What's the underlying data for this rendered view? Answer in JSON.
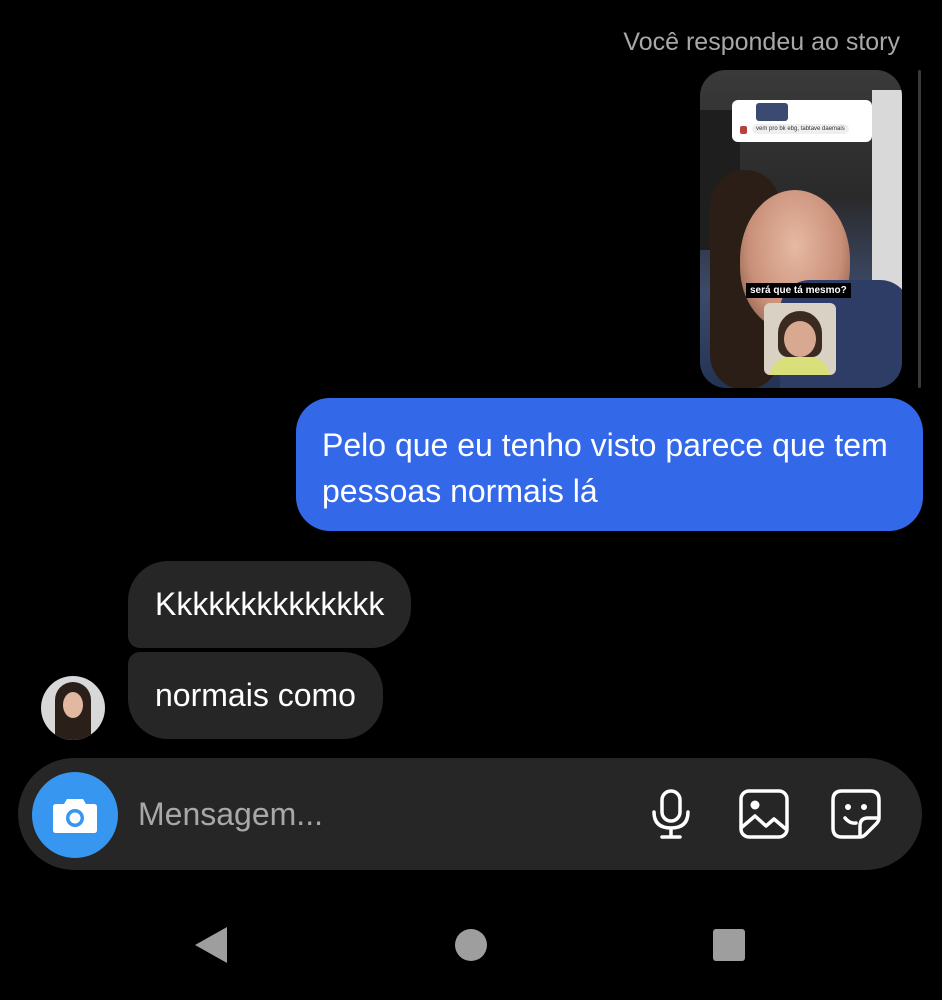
{
  "conversation": {
    "reply_label": "Você respondeu ao story",
    "story": {
      "card_text": "vem pro bk ebg, tabtave daemais",
      "caption": "será que tá mesmo?"
    },
    "messages": [
      {
        "direction": "outgoing",
        "text": "Pelo que eu tenho visto parece que tem pessoas normais lá"
      },
      {
        "direction": "incoming",
        "text": "Kkkkkkkkkkkkkk"
      },
      {
        "direction": "incoming",
        "text": "normais como"
      }
    ]
  },
  "composer": {
    "placeholder": "Mensagem...",
    "icons": [
      "camera-icon",
      "microphone-icon",
      "gallery-icon",
      "sticker-icon"
    ],
    "camera_color": "#3797f0"
  },
  "navigation": {
    "icons": [
      "back-triangle-icon",
      "home-circle-icon",
      "recents-square-icon"
    ]
  },
  "colors": {
    "background": "#000000",
    "outgoing_bubble": "#3369e8",
    "incoming_bubble": "#262626",
    "secondary_text": "#a8a8a8"
  }
}
